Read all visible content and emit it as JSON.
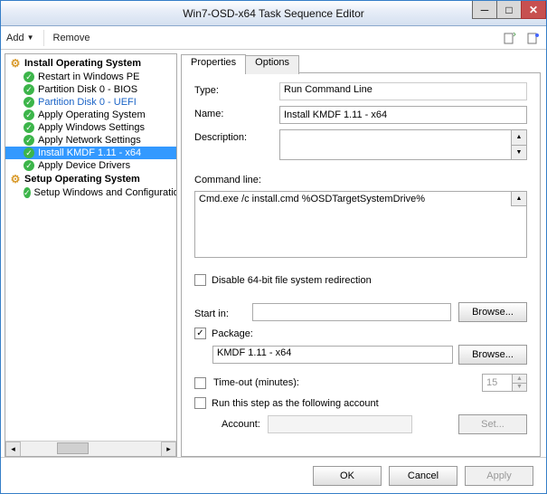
{
  "window": {
    "title": "Win7-OSD-x64 Task Sequence Editor"
  },
  "toolbar": {
    "add_label": "Add",
    "remove_label": "Remove"
  },
  "tree": {
    "group1": {
      "label": "Install Operating System"
    },
    "items1": [
      {
        "label": "Restart in Windows PE",
        "style": "normal"
      },
      {
        "label": "Partition Disk 0 - BIOS",
        "style": "normal"
      },
      {
        "label": "Partition Disk 0 - UEFI",
        "style": "blue"
      },
      {
        "label": "Apply Operating System",
        "style": "normal"
      },
      {
        "label": "Apply Windows Settings",
        "style": "normal"
      },
      {
        "label": "Apply Network Settings",
        "style": "normal"
      },
      {
        "label": "Install KMDF 1.11 - x64",
        "style": "selected"
      },
      {
        "label": "Apply Device Drivers",
        "style": "normal"
      }
    ],
    "group2": {
      "label": "Setup Operating System"
    },
    "items2": [
      {
        "label": "Setup Windows and Configuration",
        "style": "normal"
      }
    ]
  },
  "tabs": {
    "properties": "Properties",
    "options": "Options"
  },
  "form": {
    "type_label": "Type:",
    "type_value": "Run Command Line",
    "name_label": "Name:",
    "name_value": "Install KMDF 1.11 - x64",
    "desc_label": "Description:",
    "cmd_label": "Command line:",
    "cmd_value": "Cmd.exe /c install.cmd %OSDTargetSystemDrive%",
    "redirect_label": "Disable 64-bit file system redirection",
    "startin_label": "Start in:",
    "browse_label": "Browse...",
    "package_label": "Package:",
    "package_value": "KMDF 1.11 - x64",
    "timeout_label": "Time-out (minutes):",
    "timeout_value": "15",
    "runas_label": "Run this step as the following account",
    "account_label": "Account:",
    "set_label": "Set..."
  },
  "footer": {
    "ok": "OK",
    "cancel": "Cancel",
    "apply": "Apply"
  }
}
